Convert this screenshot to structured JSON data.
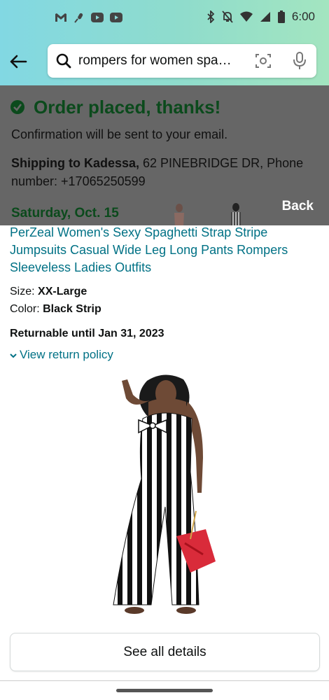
{
  "status_bar": {
    "time": "6:00",
    "icons_left": [
      "gmail-icon",
      "mic-off-icon",
      "youtube-icon",
      "youtube-icon"
    ],
    "icons_right": [
      "bluetooth-icon",
      "bell-off-icon",
      "wifi-icon",
      "signal-icon",
      "battery-icon"
    ]
  },
  "search": {
    "query": "rompers for women spa…"
  },
  "overlay": {
    "title": "Order placed, thanks!",
    "confirmation": "Confirmation will be sent to your email.",
    "shipping_label": "Shipping to Kadessa,",
    "shipping_address": " 62 PINEBRIDGE DR, Phone number: +17065250599",
    "delivery_date": "Saturday, Oct. 15",
    "back_label": "Back"
  },
  "product": {
    "title": "PerZeal Women's Sexy Spaghetti Strap Stripe Jumpsuits Casual Wide Leg Long Pants Rompers Sleeveless Ladies Outfits",
    "size_label": "Size: ",
    "size_value": "XX-Large",
    "color_label": "Color: ",
    "color_value": "Black Strip",
    "returnable": "Returnable until Jan 31, 2023",
    "policy_link": "View return policy"
  },
  "details_button": "See all details",
  "colors": {
    "accent_teal": "#007185",
    "success_green": "#0b4a1c",
    "overlay_gray": "#666666"
  }
}
